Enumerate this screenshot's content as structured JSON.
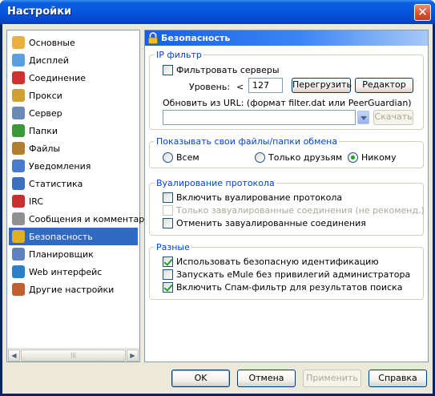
{
  "window": {
    "title": "Настройки",
    "close_glyph": "✕"
  },
  "sidebar": {
    "items": [
      {
        "label": "Основные",
        "icon": "options-icon",
        "color": "#e8b040"
      },
      {
        "label": "Дисплей",
        "icon": "display-icon",
        "color": "#5aa0e0"
      },
      {
        "label": "Соединение",
        "icon": "connection-icon",
        "color": "#d03030"
      },
      {
        "label": "Прокси",
        "icon": "proxy-icon",
        "color": "#d0a030"
      },
      {
        "label": "Сервер",
        "icon": "server-icon",
        "color": "#6a8ab8"
      },
      {
        "label": "Папки",
        "icon": "folder-icon",
        "color": "#3a9a3a"
      },
      {
        "label": "Файлы",
        "icon": "files-icon",
        "color": "#b08030"
      },
      {
        "label": "Уведомления",
        "icon": "notification-icon",
        "color": "#4a7ad0"
      },
      {
        "label": "Статистика",
        "icon": "statistics-icon",
        "color": "#3a70c0"
      },
      {
        "label": "IRC",
        "icon": "irc-icon",
        "color": "#c83030"
      },
      {
        "label": "Сообщения и комментарии",
        "icon": "messages-icon",
        "color": "#909090"
      },
      {
        "label": "Безопасность",
        "icon": "lock-icon",
        "color": "#e0b020"
      },
      {
        "label": "Планировщик",
        "icon": "scheduler-icon",
        "color": "#6080c0"
      },
      {
        "label": "Web интерфейс",
        "icon": "web-icon",
        "color": "#2a80c8"
      },
      {
        "label": "Другие настройки",
        "icon": "tweaks-icon",
        "color": "#c06030"
      }
    ],
    "selected_index": 11,
    "scroll_left": "◀",
    "scroll_right": "▶",
    "scroll_grip": "|||"
  },
  "panel": {
    "title": "Безопасность",
    "ip_filter": {
      "legend": "IP фильтр",
      "filter_servers": "Фильтровать серверы",
      "filter_servers_checked": false,
      "level_label": "Уровень:",
      "level_op": "<",
      "level_value": "127",
      "reload_button": "Перегрузить",
      "editor_button": "Редактор",
      "update_url_label": "Обновить из URL: (формат filter.dat или PeerGuardian)",
      "url_value": "",
      "download_button": "Скачать"
    },
    "share": {
      "legend": "Показывать свои файлы/папки обмена",
      "options": [
        "Всем",
        "Только друзьям",
        "Никому"
      ],
      "selected": 2
    },
    "obfuscation": {
      "legend": "Вуалирование протокола",
      "enable": "Включить вуалирование протокола",
      "enable_checked": false,
      "only_obfuscated": "Только завуалированные соединения (не рекоменд.)",
      "only_obfuscated_disabled": true,
      "reject": "Отменить завуалированные соединения",
      "reject_checked": false
    },
    "misc": {
      "legend": "Разные",
      "secure_ident": "Использовать безопасную идентификацию",
      "secure_ident_checked": true,
      "run_without_admin": "Запускать eMule без привилегий администратора",
      "run_without_admin_checked": false,
      "spam_filter": "Включить Спам-фильтр для результатов поиска",
      "spam_filter_checked": true
    }
  },
  "footer": {
    "ok": "OK",
    "cancel": "Отмена",
    "apply": "Применить",
    "help": "Справка"
  }
}
